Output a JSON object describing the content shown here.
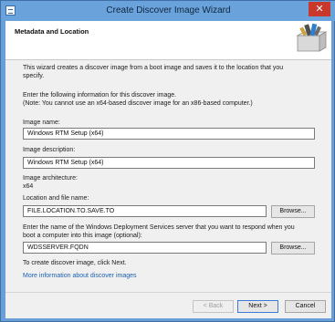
{
  "window": {
    "title": "Create Discover Image Wizard",
    "close_glyph": "✕"
  },
  "header": {
    "title": "Metadata and Location"
  },
  "intro": {
    "line1": "This wizard creates a discover image from a boot image and saves it to the location that you",
    "line2": "specify."
  },
  "instructions": {
    "line1": "Enter the following information for this discover image.",
    "line2": "(Note: You cannot use an x64-based discover image for an x86-based computer.)"
  },
  "fields": {
    "image_name_label": "Image name:",
    "image_name_value": "Windows RTM Setup (x64)",
    "image_description_label": "Image description:",
    "image_description_value": "Windows RTM Setup (x64)",
    "image_architecture_label": "Image architecture:",
    "image_architecture_value": "x64",
    "location_label": "Location and file name:",
    "location_value": "FILE.LOCATION.TO.SAVE.TO",
    "server_label_line1": "Enter the  name of the Windows Deployment Services server that you want to respond when you",
    "server_label_line2": "boot a computer into this image (optional):",
    "server_value": "WDSSERVER.FQDN",
    "browse_label": "Browse..."
  },
  "footer_text": "To create discover image, click Next.",
  "more_info_link": "More information about discover images",
  "buttons": {
    "back": "< Back",
    "next": "Next >",
    "cancel": "Cancel"
  },
  "colors": {
    "titlebar": "#6aa2db",
    "close_button": "#c9382b",
    "link": "#1c5fb0",
    "dialog_background": "#f0f0f0"
  },
  "icons": {
    "window_icon": "wizard-window-icon",
    "header_icon": "open-box-icon"
  }
}
